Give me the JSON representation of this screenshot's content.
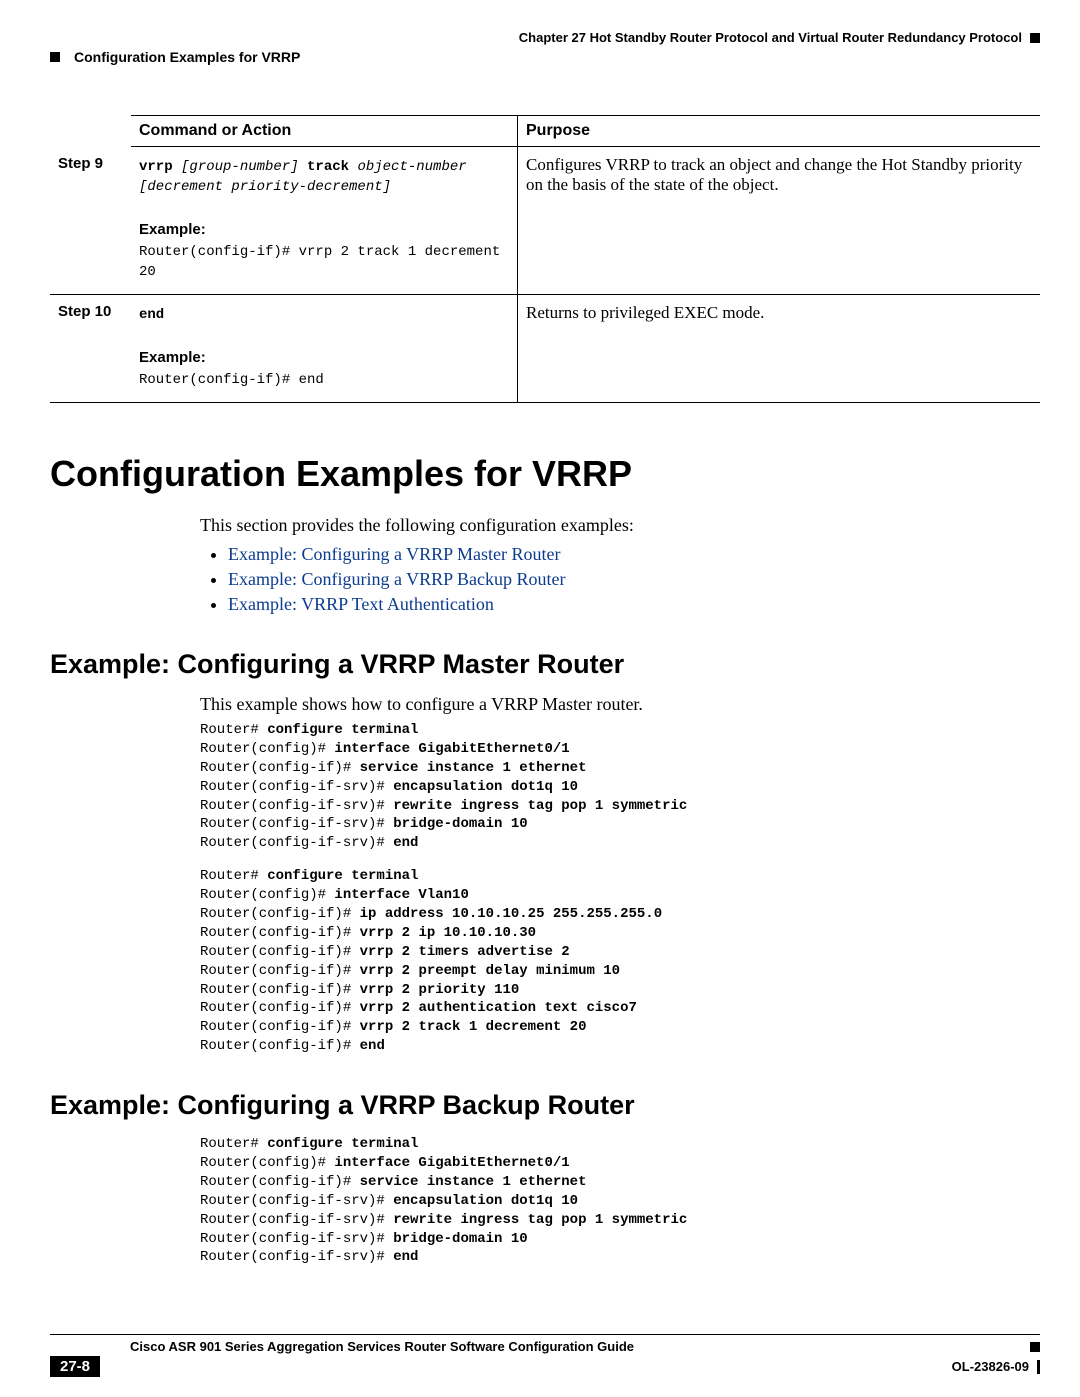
{
  "header": {
    "chapter": "Chapter 27    Hot Standby Router Protocol and Virtual Router Redundancy Protocol",
    "breadcrumb": "Configuration Examples for VRRP"
  },
  "table": {
    "col1": "Command or Action",
    "col2": "Purpose",
    "rows": [
      {
        "step": "Step 9",
        "cmd_bold1": "vrrp",
        "cmd_it1": " [group-number] ",
        "cmd_bold2": "track",
        "cmd_it2": " object-number",
        "cmd_it3": "[decrement priority-decrement]",
        "example_label": "Example:",
        "example": "Router(config-if)# vrrp 2 track 1 decrement 20",
        "purpose": "Configures VRRP to track an object and change the Hot Standby priority on the basis of the state of the object."
      },
      {
        "step": "Step 10",
        "cmd_bold1": "end",
        "example_label": "Example:",
        "example": "Router(config-if)# end",
        "purpose": "Returns to privileged EXEC mode."
      }
    ]
  },
  "section_title": "Configuration Examples for VRRP",
  "intro": "This section provides the following configuration examples:",
  "links": [
    "Example: Configuring a VRRP Master Router",
    "Example: Configuring a VRRP Backup Router",
    "Example: VRRP Text Authentication"
  ],
  "ex1": {
    "title": "Example: Configuring a VRRP Master Router",
    "desc": "This example shows how to configure a VRRP Master router.",
    "block1": [
      {
        "p": "Router# ",
        "b": "configure terminal"
      },
      {
        "p": "Router(config)# ",
        "b": "interface GigabitEthernet0/1"
      },
      {
        "p": "Router(config-if)# ",
        "b": "service instance 1 ethernet"
      },
      {
        "p": "Router(config-if-srv)# ",
        "b": "encapsulation dot1q 10"
      },
      {
        "p": "Router(config-if-srv)# ",
        "b": "rewrite ingress tag pop 1 symmetric"
      },
      {
        "p": "Router(config-if-srv)# ",
        "b": "bridge-domain 10"
      },
      {
        "p": "Router(config-if-srv)# ",
        "b": "end"
      }
    ],
    "block2": [
      {
        "p": "Router# ",
        "b": "configure terminal"
      },
      {
        "p": "Router(config)# ",
        "b": "interface Vlan10"
      },
      {
        "p": "Router(config-if)# ",
        "b": "ip address 10.10.10.25 255.255.255.0"
      },
      {
        "p": "Router(config-if)# ",
        "b": "vrrp 2 ip 10.10.10.30"
      },
      {
        "p": "Router(config-if)# ",
        "b": "vrrp 2 timers advertise 2"
      },
      {
        "p": "Router(config-if)# ",
        "b": "vrrp 2 preempt delay minimum 10"
      },
      {
        "p": "Router(config-if)# ",
        "b": "vrrp 2 priority 110"
      },
      {
        "p": "Router(config-if)# ",
        "b": "vrrp 2 authentication text cisco7"
      },
      {
        "p": "Router(config-if)# ",
        "b": "vrrp 2 track 1 decrement 20"
      },
      {
        "p": "Router(config-if)# ",
        "b": "end"
      }
    ]
  },
  "ex2": {
    "title": "Example: Configuring a VRRP Backup Router",
    "block1": [
      {
        "p": "Router# ",
        "b": "configure terminal"
      },
      {
        "p": "Router(config)# ",
        "b": "interface GigabitEthernet0/1"
      },
      {
        "p": "Router(config-if)# ",
        "b": "service instance 1 ethernet"
      },
      {
        "p": "Router(config-if-srv)# ",
        "b": "encapsulation dot1q 10"
      },
      {
        "p": "Router(config-if-srv)# ",
        "b": "rewrite ingress tag pop 1 symmetric"
      },
      {
        "p": "Router(config-if-srv)# ",
        "b": "bridge-domain 10"
      },
      {
        "p": "Router(config-if-srv)# ",
        "b": "end"
      }
    ]
  },
  "footer": {
    "guide": "Cisco ASR 901 Series Aggregation Services Router Software Configuration Guide",
    "page": "27-8",
    "doc": "OL-23826-09"
  }
}
